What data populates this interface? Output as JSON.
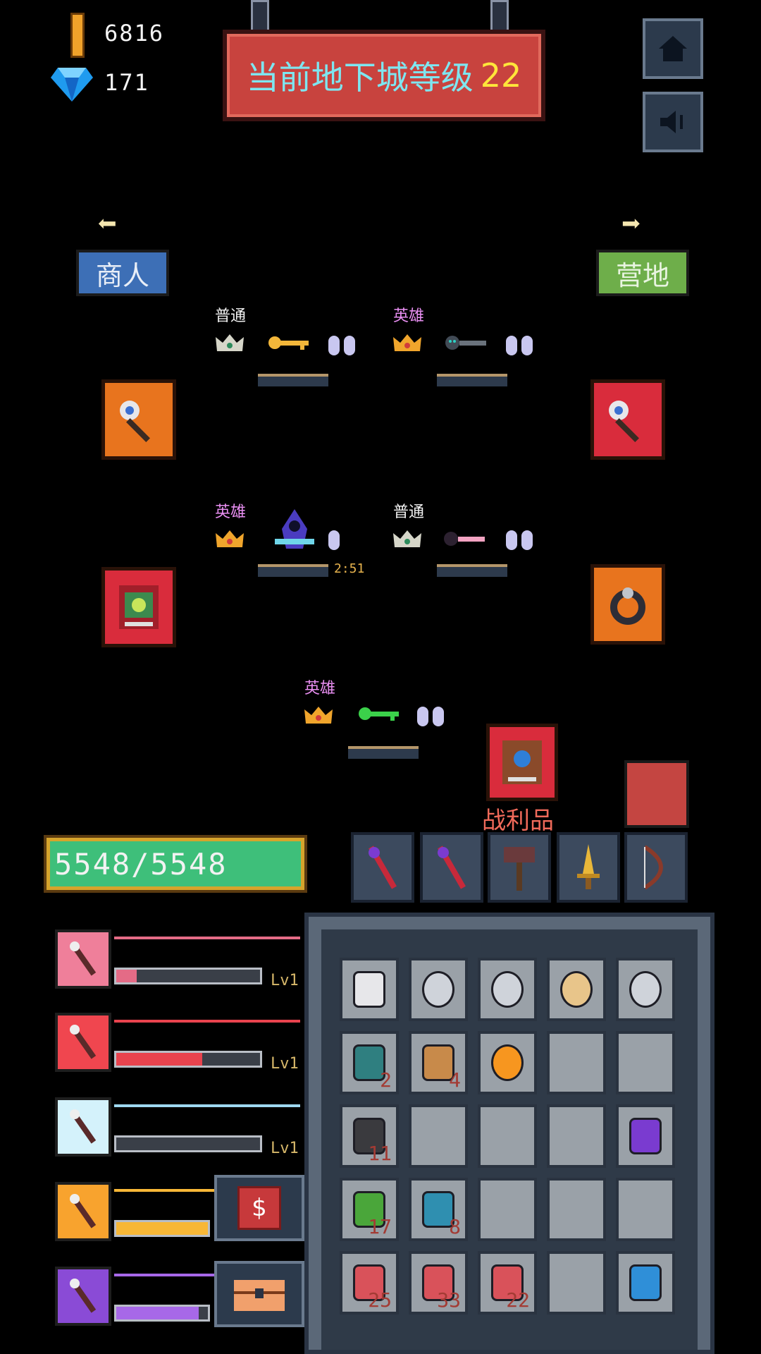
{
  "currency": {
    "gold": "6816",
    "gems": "171"
  },
  "banner": {
    "text": "当前地下城等级",
    "level": "22"
  },
  "top_buttons": [
    {
      "icon": "home-icon"
    },
    {
      "icon": "sound-icon"
    }
  ],
  "nav": {
    "left_label": "商人",
    "right_label": "营地"
  },
  "rooms": [
    {
      "rarity": "普通",
      "timer": ""
    },
    {
      "rarity": "英雄",
      "timer": ""
    },
    {
      "rarity": "英雄",
      "timer": "2:51"
    },
    {
      "rarity": "普通",
      "timer": ""
    },
    {
      "rarity": "英雄",
      "timer": ""
    }
  ],
  "hp": {
    "text": "5548/5548",
    "fraction": 1.0
  },
  "loot": {
    "label": "战利品"
  },
  "weapons": [
    {
      "icon": "eye-staff-icon",
      "level": "Lv1",
      "fill": 0.14,
      "color": "#e46b86",
      "bg": "#ef7f9a"
    },
    {
      "icon": "red-staff-icon",
      "level": "Lv1",
      "fill": 0.6,
      "color": "#e8434e",
      "bg": "#f0464f"
    },
    {
      "icon": "golden-sword-icon",
      "level": "Lv1",
      "fill": 0.0,
      "color": "#9fd8f0",
      "bg": "#d4f2fb"
    },
    {
      "icon": "winged-staff-icon",
      "level": "",
      "fill": 1.0,
      "color": "#f7b737",
      "bg": "#f8a32e"
    },
    {
      "icon": "bow-icon",
      "level": "",
      "fill": 0.9,
      "color": "#a768e8",
      "bg": "#8a4bd6"
    }
  ],
  "inventory": [
    [
      "eye-staff-icon",
      "",
      ""
    ],
    [
      "ring-icon",
      "",
      ""
    ],
    [
      "ring-icon",
      "",
      ""
    ],
    [
      "gold-ring-icon",
      "",
      ""
    ],
    [
      "ring-icon",
      "",
      ""
    ],
    [
      "teal-potion-icon",
      "2",
      ""
    ],
    [
      "gourd-icon",
      "4",
      ""
    ],
    [
      "orange-orb-icon",
      "",
      ""
    ],
    [
      "",
      "",
      ""
    ],
    [
      "",
      "",
      ""
    ],
    [
      "ore-icon",
      "11",
      ""
    ],
    [
      "",
      "",
      ""
    ],
    [
      "",
      "",
      ""
    ],
    [
      "",
      "",
      ""
    ],
    [
      "purple-axe-icon",
      "",
      ""
    ],
    [
      "green-jar-icon",
      "17",
      ""
    ],
    [
      "blue-bottle-icon",
      "8",
      ""
    ],
    [
      "",
      "",
      ""
    ],
    [
      "",
      "",
      ""
    ],
    [
      "",
      "",
      ""
    ],
    [
      "red-potion-icon",
      "25",
      ""
    ],
    [
      "red-potion-icon",
      "33",
      ""
    ],
    [
      "red-potion-icon",
      "22",
      ""
    ],
    [
      "",
      "",
      ""
    ],
    [
      "shield-icon",
      "",
      ""
    ]
  ],
  "colors": {
    "accent_gold": "#f0a22a",
    "hp_green": "#3ebf7a",
    "banner_red": "#c8433e"
  }
}
